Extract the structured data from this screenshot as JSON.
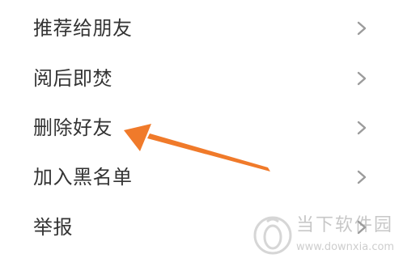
{
  "menu": {
    "items": [
      {
        "label": "推荐给朋友"
      },
      {
        "label": "阅后即焚"
      },
      {
        "label": "删除好友"
      },
      {
        "label": "加入黑名单"
      },
      {
        "label": "举报"
      }
    ]
  },
  "annotation": {
    "arrow_color": "#f07a2a",
    "points_to": "删除好友"
  },
  "watermark": {
    "name": "当下软件园",
    "url": "www.downxia.com",
    "logo_icon": "downxia-logo-icon"
  },
  "colors": {
    "text": "#333333",
    "chevron": "#9b9b9b",
    "background": "#ffffff"
  }
}
